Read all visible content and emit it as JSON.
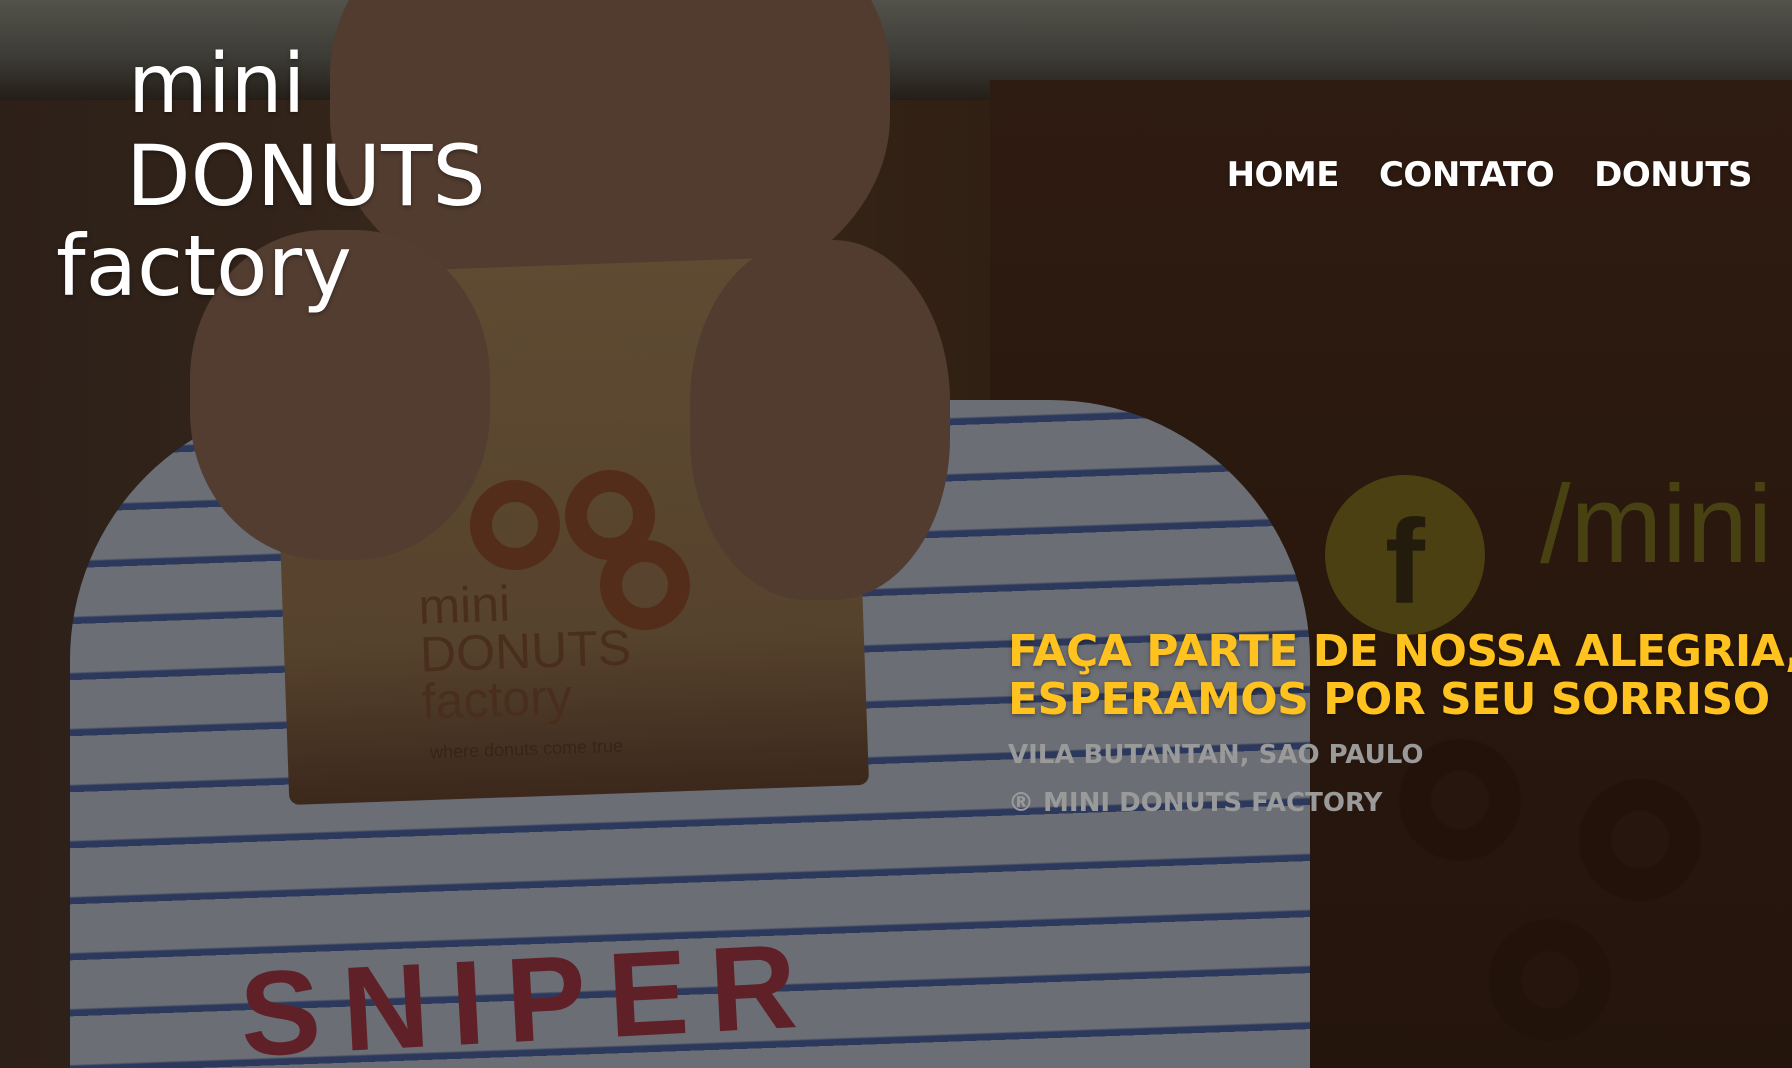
{
  "logo": {
    "line1": "mini",
    "line2": "DONUTS",
    "line3": "factory"
  },
  "nav": {
    "items": [
      "HOME",
      "CONTATO",
      "DONUTS"
    ]
  },
  "hero": {
    "headline_line1": "FAÇA PARTE DE NOSSA ALEGRIA,",
    "headline_line2": "ESPERAMOS POR SEU SORRISO",
    "location": "VILA BUTANTAN, SAO PAULO",
    "copyright": "® MINI DONUTS FACTORY"
  },
  "background": {
    "description_icons": [
      "facebook-icon"
    ],
    "facebook_handle": "/mini",
    "bag_logo": "mini\nDONUTS\nfactory",
    "bag_tagline": "where donuts come true",
    "shirt_text": "SNIPER"
  },
  "colors": {
    "headline": "#ffc21e",
    "nav_text": "#ffffff",
    "secondary_text": "#9a9a9a"
  }
}
